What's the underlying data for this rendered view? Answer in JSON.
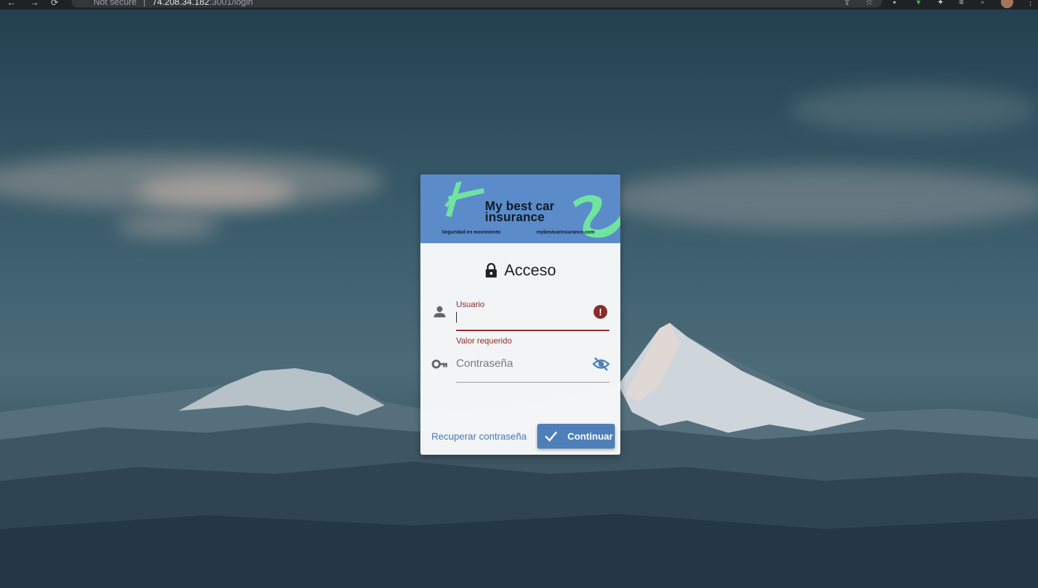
{
  "browser": {
    "back": "←",
    "forward": "→",
    "reload": "⟳",
    "security": "Not secure",
    "separator": "|",
    "url_host": "74.208.34.182",
    "url_rest": ":3001/login"
  },
  "banner": {
    "brand_line1": "My best car",
    "brand_line2": "insurance",
    "tagline": "Seguridad en movimiento",
    "website": "mybestcarinsurance.com",
    "colors": {
      "background": "#5b8cc9",
      "accent": "#6fe3a0"
    }
  },
  "login": {
    "title": "Acceso",
    "username_label": "Usuario",
    "username_value": "",
    "username_error": "Valor requerido",
    "password_placeholder": "Contraseña",
    "recover_link": "Recuperar contraseña",
    "submit_label": "Continuar",
    "colors": {
      "error": "#8c2a2a",
      "primary": "#4e7fb8"
    }
  },
  "icons": {
    "lock": "lock-icon",
    "user": "person-icon",
    "password": "key-icon",
    "error": "error-icon",
    "visibility": "eye-off-icon",
    "submit": "check-icon"
  }
}
